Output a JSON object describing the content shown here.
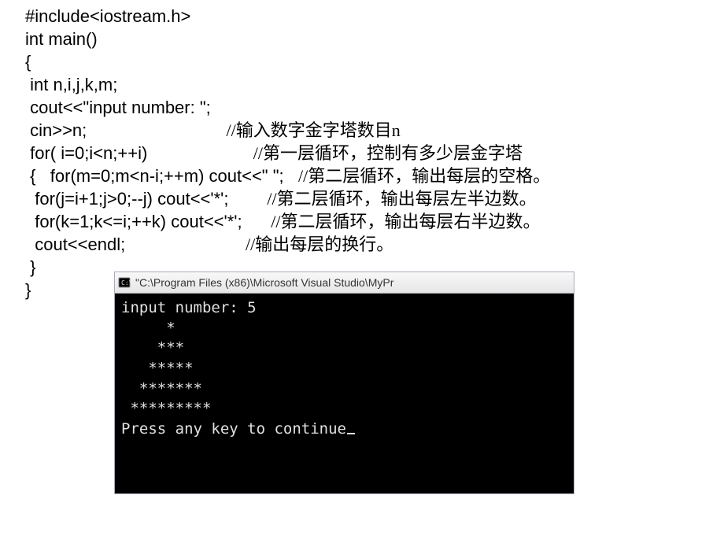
{
  "code": {
    "l1": "#include<iostream.h>",
    "l2": "int main()",
    "l3": "{",
    "l4": " int n,i,j,k,m;",
    "l5": " cout<<\"input number: \";",
    "l6a": " cin>>n;",
    "l6c": "//输入数字金字塔数目n",
    "l7a": " for( i=0;i<n;++i)",
    "l7c": "//第一层循环，控制有多少层金字塔",
    "l8a": " {   for(m=0;m<n-i;++m) cout<<\" \";",
    "l8c": "//第二层循环，输出每层的空格。",
    "l9a": "  for(j=i+1;j>0;--j) cout<<'*';",
    "l9c": "//第二层循环，输出每层左半边数。",
    "l10a": "  for(k=1;k<=i;++k) cout<<'*';",
    "l10c": "//第二层循环，输出每层右半边数。",
    "l11a": "  cout<<endl;",
    "l11c": "//输出每层的换行。",
    "l12": " }",
    "l13": "}"
  },
  "console": {
    "title": "\"C:\\Program Files (x86)\\Microsoft Visual Studio\\MyPr",
    "lines": {
      "prompt": "input number: 5",
      "row1": "     *",
      "row2": "    ***",
      "row3": "   *****",
      "row4": "  *******",
      "row5": " *********",
      "press": "Press any key to continue"
    }
  }
}
